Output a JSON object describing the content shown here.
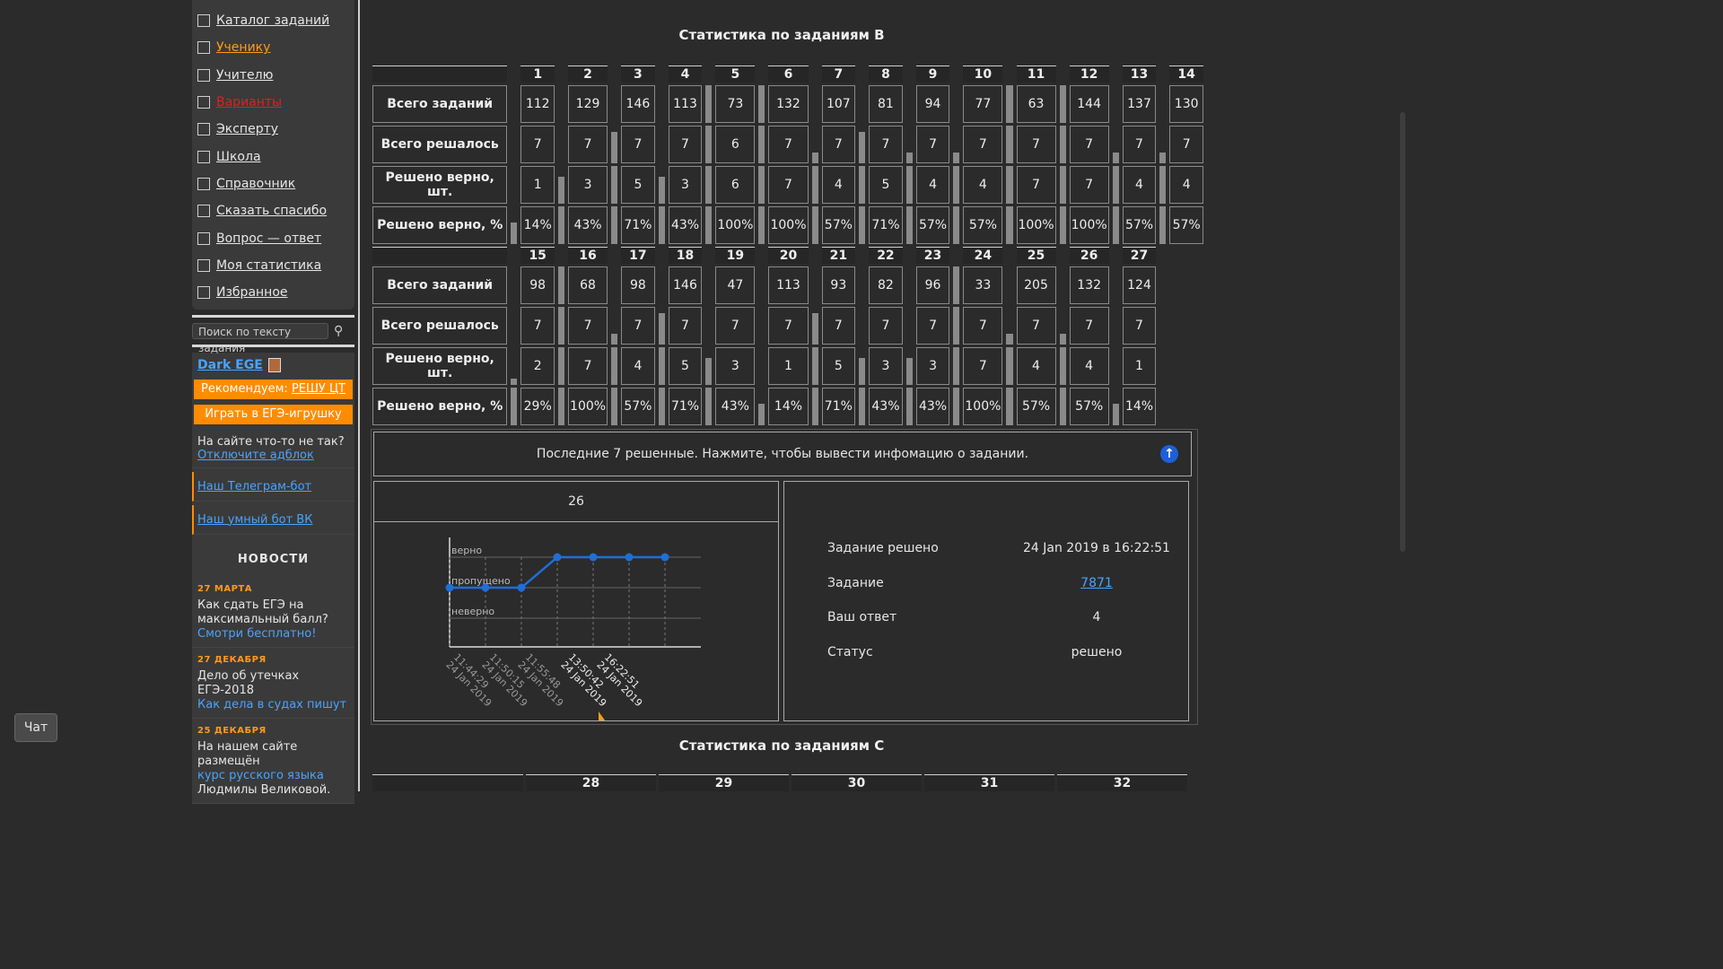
{
  "sidebar": {
    "menu": [
      {
        "label": "Каталог заданий",
        "style": "normal"
      },
      {
        "label": "Ученику",
        "style": "orange"
      },
      {
        "label": "Учителю",
        "style": "normal"
      },
      {
        "label": "Варианты",
        "style": "red"
      },
      {
        "label": "Эксперту",
        "style": "normal"
      },
      {
        "label": "Школа",
        "style": "normal"
      },
      {
        "label": "Справочник",
        "style": "normal"
      },
      {
        "label": "Сказать спасибо",
        "style": "normal"
      },
      {
        "label": "Вопрос — ответ",
        "style": "normal"
      },
      {
        "label": "Моя статистика",
        "style": "normal"
      },
      {
        "label": "Избранное",
        "style": "normal"
      }
    ],
    "search_placeholder": "Поиск по тексту задания",
    "dark_ege": "Dark EGE",
    "recommend_prefix": "Рекомендуем: ",
    "recommend_link": "РЕШУ ЦТ",
    "play_label": "Играть в ЕГЭ-игрушку",
    "adblock_text": "На сайте что-то не так?",
    "adblock_link": "Отключите адблок",
    "telegram": "Наш Телеграм-бот",
    "vk": "Наш умный бот ВК",
    "news_heading": "НОВОСТИ",
    "news": [
      {
        "date": "27 МАРТА",
        "text": "Как сдать ЕГЭ на максимальный балл?",
        "link": "Смотри бесплатно!",
        "tail": ""
      },
      {
        "date": "27 ДЕКАБРЯ",
        "text": "Дело об утечках ЕГЭ-2018",
        "link": "Как дела в судах пишут",
        "tail": ""
      },
      {
        "date": "25 ДЕКАБРЯ",
        "text": "На нашем сайте размещён",
        "link": "курс русского языка",
        "tail": "Людмилы Великовой."
      }
    ],
    "chat": "Чат"
  },
  "stats_b": {
    "title": "Статистика по заданиям B",
    "row_labels": [
      "Всего заданий",
      "Всего решалось",
      "Решено верно, шт.",
      "Решено верно, %"
    ],
    "blocks": [
      {
        "numbers": [
          "1",
          "2",
          "3",
          "4",
          "5",
          "6",
          "7",
          "8",
          "9",
          "10",
          "11",
          "12",
          "13",
          "14"
        ],
        "total": [
          "112",
          "129",
          "146",
          "113",
          "73",
          "132",
          "107",
          "81",
          "94",
          "77",
          "63",
          "144",
          "137",
          "130"
        ],
        "attempted": [
          "7",
          "7",
          "7",
          "7",
          "6",
          "7",
          "7",
          "7",
          "7",
          "7",
          "7",
          "7",
          "7",
          "7"
        ],
        "correct": [
          "1",
          "3",
          "5",
          "3",
          "6",
          "7",
          "4",
          "5",
          "4",
          "4",
          "7",
          "7",
          "4",
          "4"
        ],
        "percent": [
          "14%",
          "43%",
          "71%",
          "43%",
          "100%",
          "100%",
          "57%",
          "71%",
          "57%",
          "57%",
          "100%",
          "100%",
          "57%",
          "57%"
        ],
        "fraction": [
          0.14,
          0.43,
          0.71,
          0.43,
          1,
          1,
          0.57,
          0.71,
          0.57,
          0.57,
          1,
          1,
          0.57,
          0.57
        ]
      },
      {
        "numbers": [
          "15",
          "16",
          "17",
          "18",
          "19",
          "20",
          "21",
          "22",
          "23",
          "24",
          "25",
          "26",
          "27"
        ],
        "total": [
          "98",
          "68",
          "98",
          "146",
          "47",
          "113",
          "93",
          "82",
          "96",
          "33",
          "205",
          "132",
          "124"
        ],
        "attempted": [
          "7",
          "7",
          "7",
          "7",
          "7",
          "7",
          "7",
          "7",
          "7",
          "7",
          "7",
          "7",
          "7"
        ],
        "correct": [
          "2",
          "7",
          "4",
          "5",
          "3",
          "1",
          "5",
          "3",
          "3",
          "7",
          "4",
          "4",
          "1"
        ],
        "percent": [
          "29%",
          "100%",
          "57%",
          "71%",
          "43%",
          "14%",
          "71%",
          "43%",
          "43%",
          "100%",
          "57%",
          "57%",
          "14%"
        ],
        "fraction": [
          0.29,
          1,
          0.57,
          0.71,
          0.43,
          0.14,
          0.71,
          0.43,
          0.43,
          1,
          0.57,
          0.57,
          0.14
        ]
      }
    ]
  },
  "last_solved": {
    "header": "Последние 7 решенные. Нажмите, чтобы вывести инфомацию о задании.",
    "chart_title": "26",
    "y_labels": [
      "верно",
      "пропущено",
      "неверно"
    ],
    "x_labels": [
      "11:44:29\n24 Jan 2019",
      "11:50:15\n24 Jan 2019",
      "11:55:48\n24 Jan 2019",
      "13:50:42\n24 Jan 2019",
      "16:22:51\n24 Jan 2019"
    ],
    "info": [
      {
        "k": "Задание решено",
        "v": "24 Jan 2019 в 16:22:51",
        "link": false
      },
      {
        "k": "Задание",
        "v": "7871",
        "link": true
      },
      {
        "k": "Ваш ответ",
        "v": "4",
        "link": false
      },
      {
        "k": "Статус",
        "v": "решено",
        "link": false
      }
    ]
  },
  "chart_data": {
    "type": "line",
    "categories": [
      "11:44:29 24 Jan 2019",
      "",
      "11:50:15 24 Jan 2019",
      "11:55:48 24 Jan 2019",
      "13:50:42 24 Jan 2019",
      "16:22:51 24 Jan 2019",
      ""
    ],
    "y_categories": [
      "неверно",
      "пропущено",
      "верно"
    ],
    "values": [
      1,
      1,
      1,
      2,
      2,
      2,
      2
    ],
    "title": "26"
  },
  "stats_c": {
    "title": "Статистика по заданиям C",
    "numbers": [
      "28",
      "29",
      "30",
      "31",
      "32"
    ]
  }
}
